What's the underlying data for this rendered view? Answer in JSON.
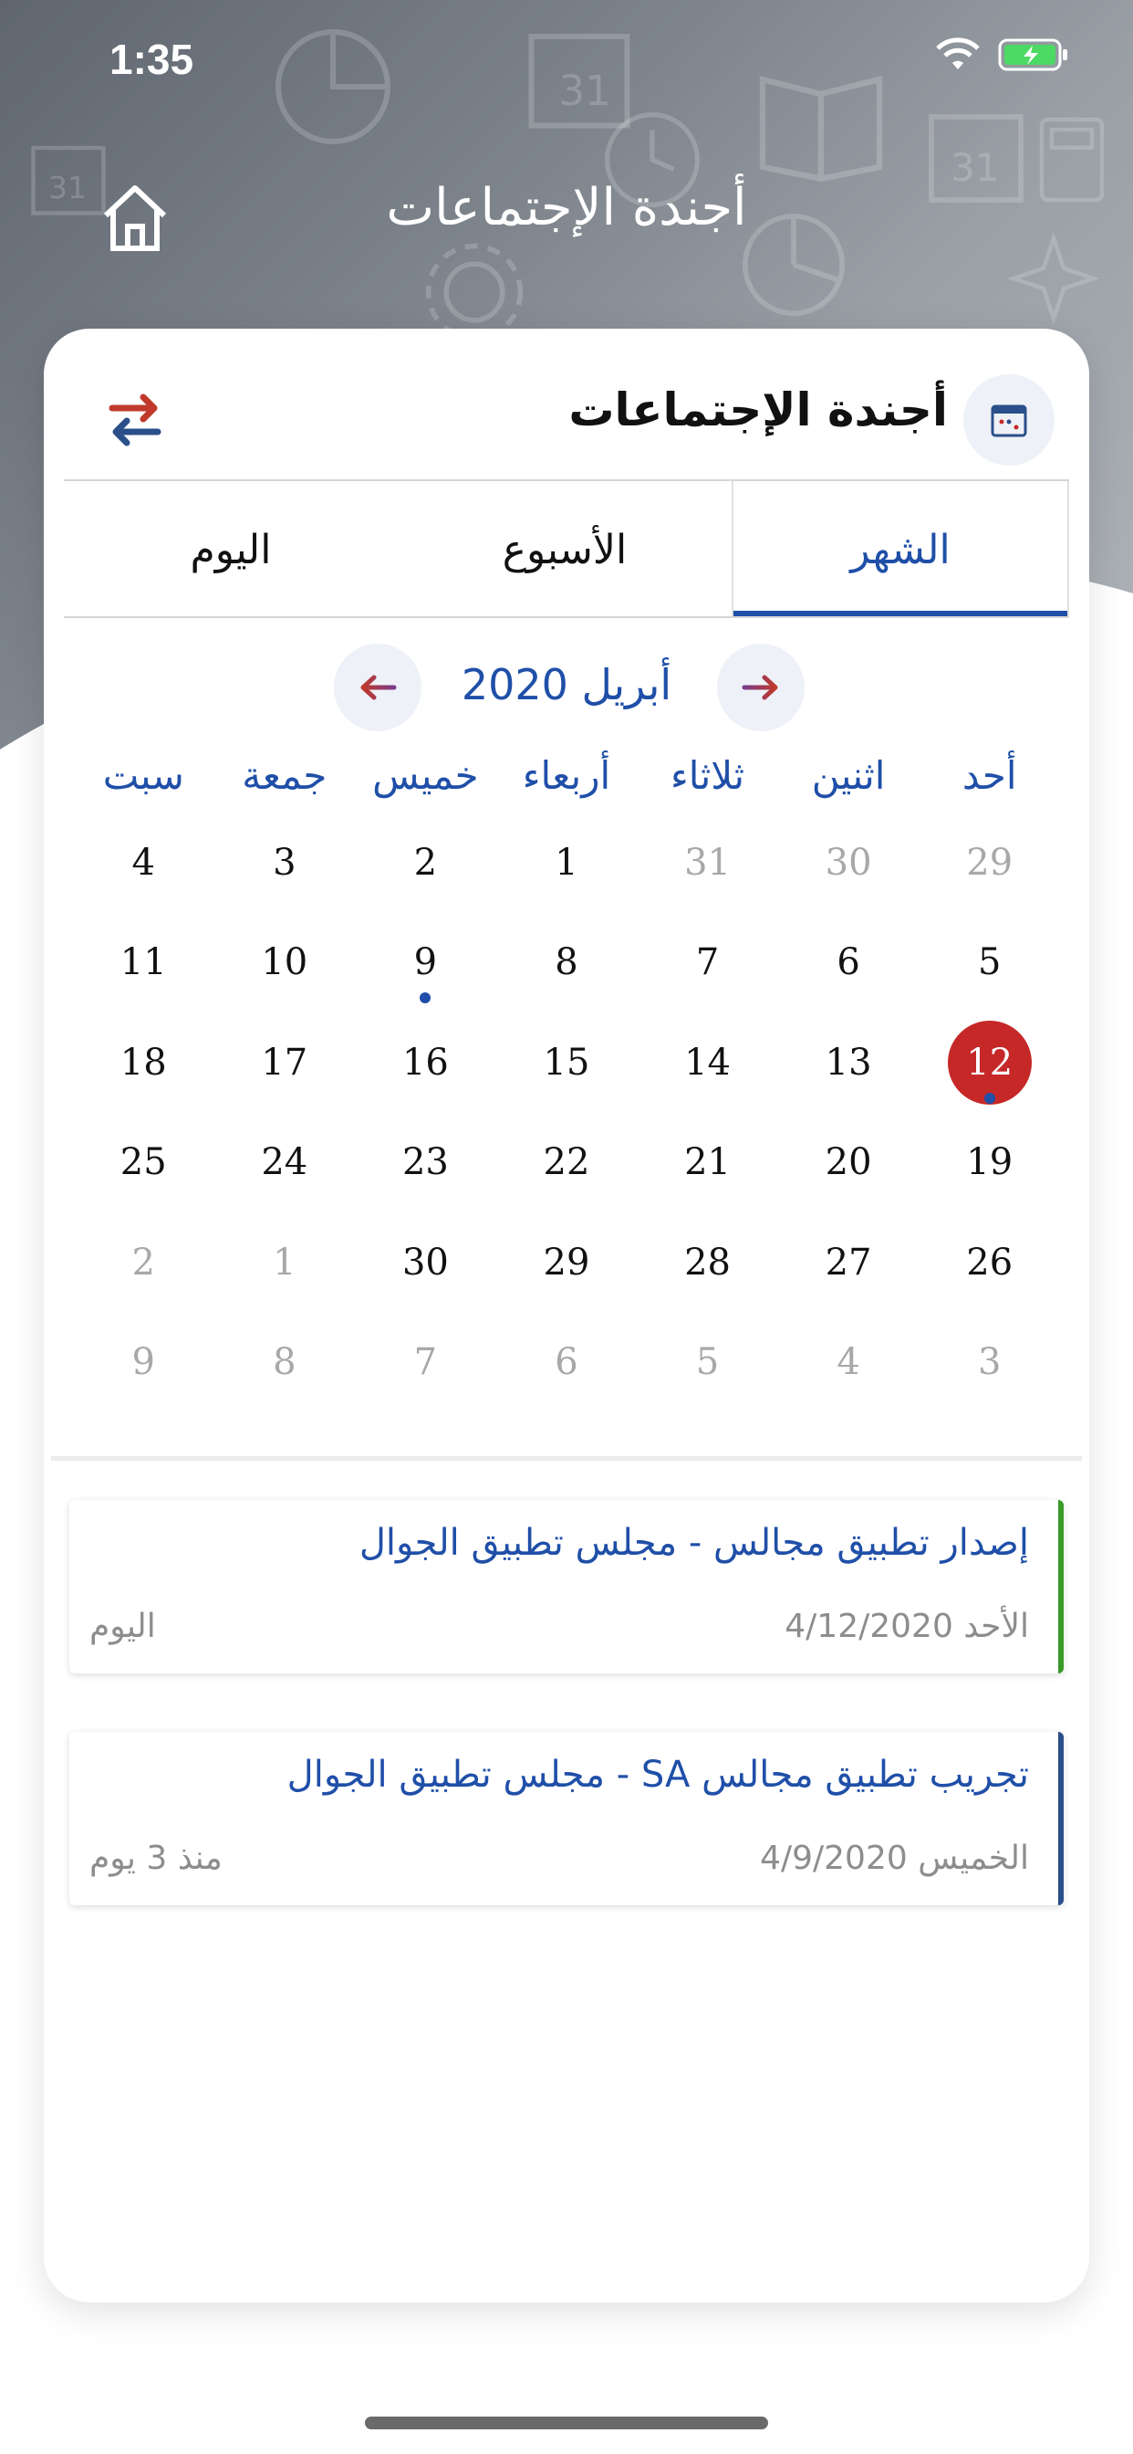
{
  "status": {
    "time": "1:35"
  },
  "header": {
    "title": "أجندة الإجتماعات"
  },
  "card": {
    "title": "أجندة الإجتماعات"
  },
  "tabs": [
    {
      "label": "الشهر",
      "active": true
    },
    {
      "label": "الأسبوع",
      "active": false
    },
    {
      "label": "اليوم",
      "active": false
    }
  ],
  "calendar": {
    "month_label": "أبريل 2020",
    "weekdays": [
      "أحد",
      "اثنين",
      "ثلاثاء",
      "أربعاء",
      "خميس",
      "جمعة",
      "سبت"
    ],
    "rows": [
      [
        "29",
        "30",
        "31",
        "1",
        "2",
        "3",
        "4"
      ],
      [
        "5",
        "6",
        "7",
        "8",
        "9",
        "10",
        "11"
      ],
      [
        "12",
        "13",
        "14",
        "15",
        "16",
        "17",
        "18"
      ],
      [
        "19",
        "20",
        "21",
        "22",
        "23",
        "24",
        "25"
      ],
      [
        "26",
        "27",
        "28",
        "29",
        "30",
        "1",
        "2"
      ],
      [
        "3",
        "4",
        "5",
        "6",
        "7",
        "8",
        "9"
      ]
    ],
    "muted": [
      [
        true,
        true,
        true,
        false,
        false,
        false,
        false
      ],
      [
        false,
        false,
        false,
        false,
        false,
        false,
        false
      ],
      [
        false,
        false,
        false,
        false,
        false,
        false,
        false
      ],
      [
        false,
        false,
        false,
        false,
        false,
        false,
        false
      ],
      [
        false,
        false,
        false,
        false,
        false,
        true,
        true
      ],
      [
        true,
        true,
        true,
        true,
        true,
        true,
        true
      ]
    ],
    "today": [
      2,
      0
    ],
    "event_days": [
      [
        1,
        4
      ],
      [
        2,
        0
      ]
    ]
  },
  "events": [
    {
      "title": "إصدار تطبيق مجالس - مجلس تطبيق الجوال",
      "date": "الأحد 4/12/2020",
      "relative": "اليوم",
      "accent": "#3a9a2a"
    },
    {
      "title": "تجريب تطبيق مجالس SA - مجلس تطبيق الجوال",
      "date": "الخميس 4/9/2020",
      "relative": "منذ 3 يوم",
      "accent": "#2a4f8a"
    }
  ],
  "colors": {
    "primary": "#1f4fa8",
    "today": "#c62828"
  }
}
